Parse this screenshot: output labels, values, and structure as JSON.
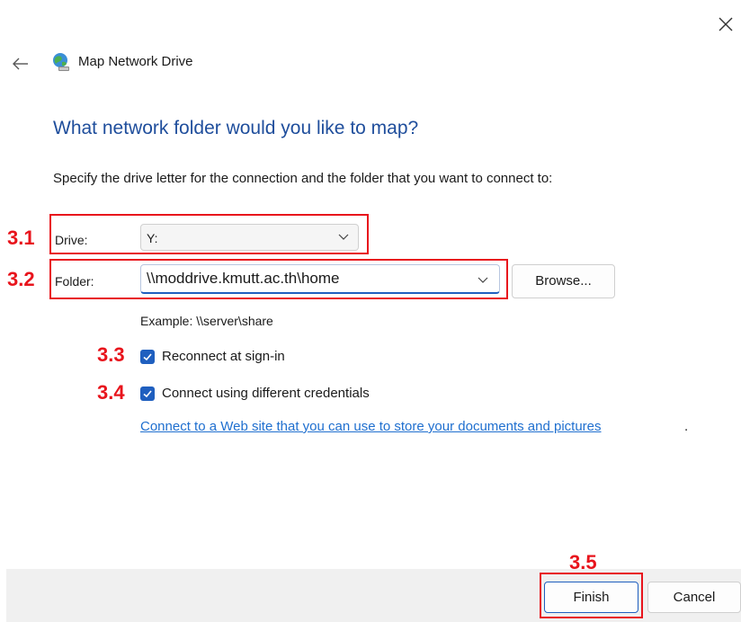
{
  "window": {
    "title": "Map Network Drive",
    "close_icon": "close-icon",
    "back_icon": "back-arrow-icon",
    "title_icon": "network-drive-globe-icon"
  },
  "heading": "What network folder would you like to map?",
  "instruction": "Specify the drive letter for the connection and the folder that you want to connect to:",
  "annotations": {
    "drive": "3.1",
    "folder": "3.2",
    "reconnect": "3.3",
    "credentials": "3.4",
    "finish": "3.5"
  },
  "drive": {
    "label": "Drive:",
    "value": "Y:"
  },
  "folder": {
    "label": "Folder:",
    "value": "\\\\moddrive.kmutt.ac.th\\home",
    "browse_label": "Browse...",
    "example": "Example: \\\\server\\share"
  },
  "options": {
    "reconnect": {
      "label": "Reconnect at sign-in",
      "checked": true
    },
    "credentials": {
      "label": "Connect using different credentials",
      "checked": true
    }
  },
  "link": {
    "text": "Connect to a Web site that you can use to store your documents and pictures",
    "trailing": "."
  },
  "footer": {
    "finish_label": "Finish",
    "cancel_label": "Cancel"
  },
  "colors": {
    "accent": "#1f5fbf",
    "heading": "#1f4e9c",
    "annotation": "#e8141c",
    "link": "#1f6fcf"
  }
}
